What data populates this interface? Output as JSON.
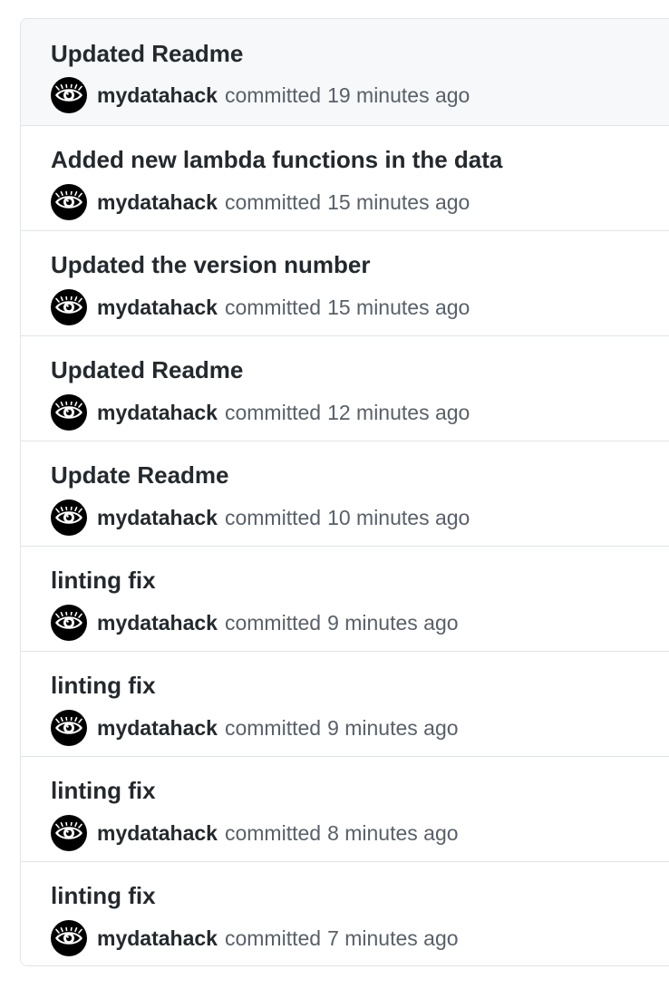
{
  "commits": [
    {
      "message": "Updated Readme",
      "author": "mydatahack",
      "action": "committed",
      "time": "19 minutes ago"
    },
    {
      "message": "Added new lambda functions in the data",
      "author": "mydatahack",
      "action": "committed",
      "time": "15 minutes ago"
    },
    {
      "message": "Updated the version number",
      "author": "mydatahack",
      "action": "committed",
      "time": "15 minutes ago"
    },
    {
      "message": "Updated Readme",
      "author": "mydatahack",
      "action": "committed",
      "time": "12 minutes ago"
    },
    {
      "message": "Update Readme",
      "author": "mydatahack",
      "action": "committed",
      "time": "10 minutes ago"
    },
    {
      "message": "linting fix",
      "author": "mydatahack",
      "action": "committed",
      "time": "9 minutes ago"
    },
    {
      "message": "linting fix",
      "author": "mydatahack",
      "action": "committed",
      "time": "9 minutes ago"
    },
    {
      "message": "linting fix",
      "author": "mydatahack",
      "action": "committed",
      "time": "8 minutes ago"
    },
    {
      "message": "linting fix",
      "author": "mydatahack",
      "action": "committed",
      "time": "7 minutes ago"
    }
  ],
  "avatar_icon": "eye-icon",
  "colors": {
    "text_primary": "#24292e",
    "text_secondary": "#586069",
    "border": "#e1e4e8",
    "row_highlight": "#f6f8fa",
    "avatar_bg": "#000000"
  }
}
